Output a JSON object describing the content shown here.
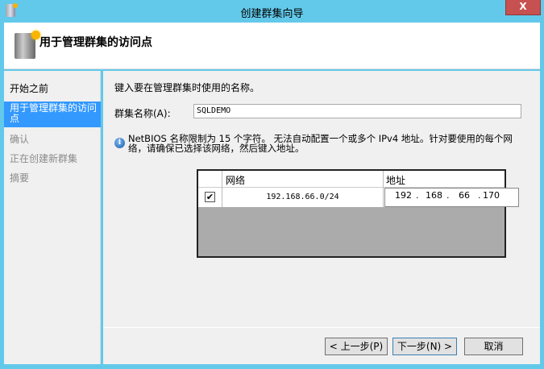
{
  "window": {
    "title": "创建群集向导",
    "close_label": "X"
  },
  "header": {
    "title": "用于管理群集的访问点"
  },
  "nav": {
    "items": [
      {
        "label": "开始之前",
        "state": "normal"
      },
      {
        "label": "用于管理群集的访问点",
        "state": "selected"
      },
      {
        "label": "确认",
        "state": "disabled"
      },
      {
        "label": "正在创建新群集",
        "state": "disabled"
      },
      {
        "label": "摘要",
        "state": "disabled"
      }
    ]
  },
  "main": {
    "instruction": "键入要在管理群集时使用的名称。",
    "cluster_name_label": "群集名称(A):",
    "cluster_name_value": "SQLDEMO",
    "info_text": "NetBIOS 名称限制为 15 个字符。 无法自动配置一个或多个 IPv4 地址。针对要使用的每个网络，请确保已选择该网络，然后键入地址。",
    "table": {
      "headers": [
        "网络",
        "地址"
      ],
      "rows": [
        {
          "checked": true,
          "network": "192.168.66.0/24",
          "address": [
            "192",
            "168",
            "66",
            "170"
          ]
        }
      ]
    }
  },
  "buttons": {
    "back": "< 上一步(P)",
    "next": "下一步(N) >",
    "cancel": "取消"
  },
  "colors": {
    "frame": "#63c9ea",
    "selected": "#3399ff",
    "close": "#c75050"
  }
}
